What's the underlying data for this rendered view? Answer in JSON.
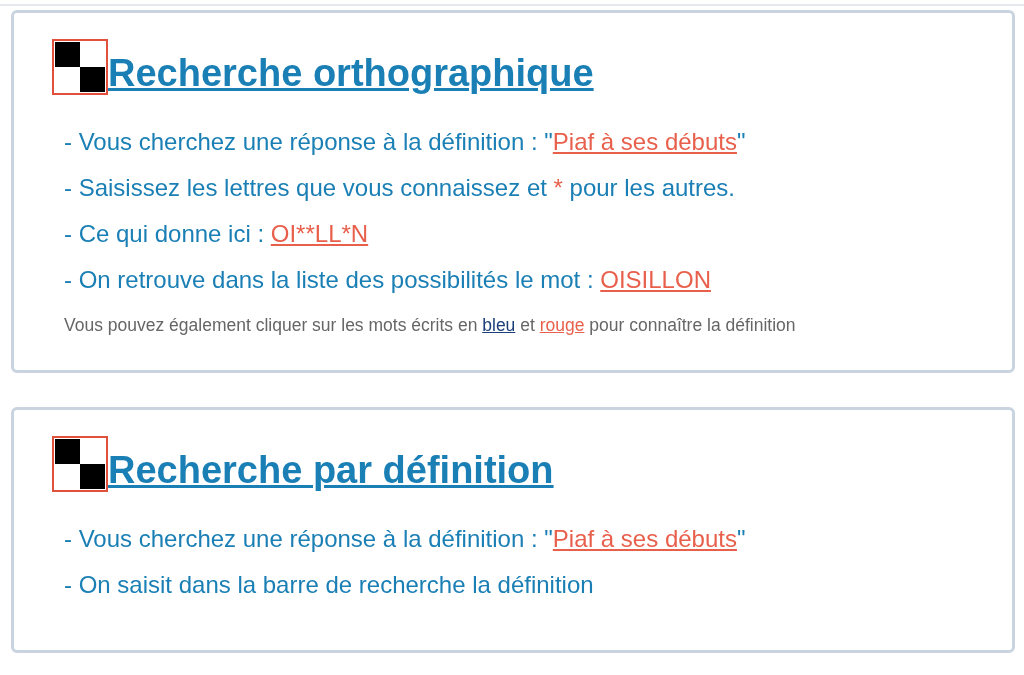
{
  "sections": [
    {
      "title": "Recherche orthographique",
      "lines": [
        [
          {
            "kind": "text",
            "text": "- Vous cherchez une réponse à la définition : \""
          },
          {
            "kind": "link",
            "color": "#e8604c",
            "text": "Piaf à ses débuts"
          },
          {
            "kind": "text",
            "text": "\""
          }
        ],
        [
          {
            "kind": "text",
            "text": "- Saisissez les lettres que vous connaissez et "
          },
          {
            "kind": "star",
            "text": "*"
          },
          {
            "kind": "text",
            "text": " pour les autres."
          }
        ],
        [
          {
            "kind": "text",
            "text": "- Ce qui donne ici : "
          },
          {
            "kind": "link",
            "color": "#e8604c",
            "text": "OI**LL*N"
          }
        ],
        [
          {
            "kind": "text",
            "text": "- On retrouve dans la liste des possibilités le mot : "
          },
          {
            "kind": "link",
            "color": "#e8604c",
            "text": "OISILLON"
          }
        ]
      ],
      "note": [
        {
          "kind": "text",
          "text": "Vous pouvez également cliquer sur les mots écrits en "
        },
        {
          "kind": "link",
          "color": "#1b3f7a",
          "text": "bleu"
        },
        {
          "kind": "text",
          "text": " et "
        },
        {
          "kind": "link",
          "color": "#e8604c",
          "text": "rouge"
        },
        {
          "kind": "text",
          "text": " pour connaître la définition"
        }
      ]
    },
    {
      "title": "Recherche par définition",
      "lines": [
        [
          {
            "kind": "text",
            "text": "- Vous cherchez une réponse à la définition : \""
          },
          {
            "kind": "link",
            "color": "#e8604c",
            "text": "Piaf à ses débuts"
          },
          {
            "kind": "text",
            "text": "\""
          }
        ],
        [
          {
            "kind": "text",
            "text": "- On saisit dans la barre de recherche la définition"
          }
        ]
      ]
    }
  ]
}
